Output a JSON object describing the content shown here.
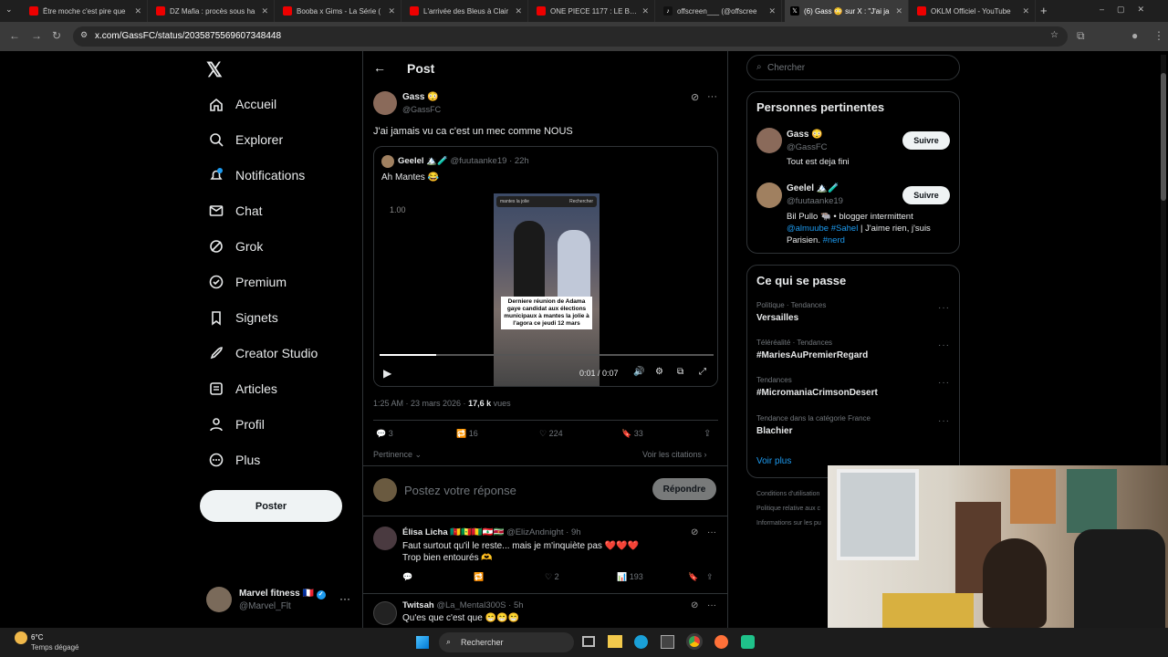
{
  "browser": {
    "tabs": [
      {
        "title": "Être moche c'est pire que",
        "icon": "youtube-icon",
        "active": false
      },
      {
        "title": "DZ Mafia : procès sous ha",
        "icon": "youtube-icon",
        "active": false
      },
      {
        "title": "Booba x Gims - La Série (",
        "icon": "youtube-icon",
        "active": false
      },
      {
        "title": "L'arrivée des Bleus à Clair",
        "icon": "youtube-icon",
        "active": false
      },
      {
        "title": "ONE PIECE 1177 : LE BORD",
        "icon": "youtube-icon",
        "active": false
      },
      {
        "title": "offscreen___ (@offscree",
        "icon": "tiktok-icon",
        "active": false
      },
      {
        "title": "(6) Gass 😳 sur X : \"J'ai ja",
        "icon": "x-icon",
        "active": true
      },
      {
        "title": "OKLM Officiel - YouTube",
        "icon": "youtube-icon",
        "active": false
      }
    ],
    "url": "x.com/GassFC/status/2035875569607348448"
  },
  "sidebar": {
    "items": [
      {
        "label": "Accueil",
        "icon": "home-icon"
      },
      {
        "label": "Explorer",
        "icon": "search-icon"
      },
      {
        "label": "Notifications",
        "icon": "bell-icon"
      },
      {
        "label": "Chat",
        "icon": "mail-icon"
      },
      {
        "label": "Grok",
        "icon": "grok-icon"
      },
      {
        "label": "Premium",
        "icon": "premium-icon"
      },
      {
        "label": "Signets",
        "icon": "bookmark-icon"
      },
      {
        "label": "Creator Studio",
        "icon": "rocket-icon"
      },
      {
        "label": "Articles",
        "icon": "article-icon"
      },
      {
        "label": "Profil",
        "icon": "person-icon"
      },
      {
        "label": "Plus",
        "icon": "more-circle-icon"
      }
    ],
    "post_button": "Poster",
    "account": {
      "name": "Marvel fitness 🇫🇷",
      "handle": "@Marvel_Flt"
    }
  },
  "post": {
    "header_title": "Post",
    "author": {
      "name": "Gass 😳",
      "handle": "@GassFC"
    },
    "text": "J'ai jamais vu ca c'est un mec comme NOUS",
    "quoted": {
      "name": "Geelel 🏔️🧪",
      "handle": "@fuutaanke19",
      "time": "· 22h",
      "text": "Ah Mantes 😂",
      "video": {
        "speed_label": "1.00",
        "search_text": "mantes la jolie",
        "search_btn": "Rechercher",
        "caption": "Derniere réunion de Adama gaye candidat aux élections municipaux à mantes la jolie à l'agora ce jeudi 12 mars",
        "time": "0:01 / 0:07",
        "progress": 0.17
      }
    },
    "meta_time": "1:25 AM · 23 mars 2026 ·",
    "views_count": "17,6 k",
    "views_label": "vues",
    "stats": {
      "replies": "3",
      "reposts": "16",
      "likes": "224",
      "bookmarks": "33"
    },
    "sort_label": "Pertinence",
    "quotes_link": "Voir les citations",
    "reply_placeholder": "Postez votre réponse",
    "reply_button": "Répondre"
  },
  "replies": [
    {
      "name": "Élisa Licha 🇨🇲🇸🇳🇬🇳🇱🇧🇸🇷",
      "handle": "@ElizAndnight",
      "time": "· 9h",
      "text": "Faut surtout qu'il le reste... mais je m'inquiète pas ❤️❤️❤️\nTrop bien entourés 🫶",
      "stats": {
        "replies": "",
        "reposts": "",
        "likes": "2",
        "views": "193"
      }
    },
    {
      "name": "Twitsah",
      "handle": "@La_Mental300S",
      "time": "· 5h",
      "text": "Qu'es que c'est que 😁😁😁"
    }
  ],
  "right": {
    "search_placeholder": "Chercher",
    "relevant_title": "Personnes pertinentes",
    "people": [
      {
        "name": "Gass 😳",
        "handle": "@GassFC",
        "bio": "Tout est deja fini",
        "follow": "Suivre"
      },
      {
        "name": "Geelel 🏔️🧪",
        "handle": "@fuutaanke19",
        "bio_plain": "Bil Pullo 🐃 • blogger intermittent",
        "bio_links": [
          "@almuube",
          "#Sahel"
        ],
        "bio_tail": "| J'aime rien, j'suis Parisien.",
        "bio_tag": "#nerd",
        "follow": "Suivre"
      }
    ],
    "trends_title": "Ce qui se passe",
    "trends": [
      {
        "category": "Politique · Tendances",
        "name": "Versailles"
      },
      {
        "category": "Téléréalité · Tendances",
        "name": "#MariesAuPremierRegard"
      },
      {
        "category": "Tendances",
        "name": "#MicromaniaCrimsonDesert"
      },
      {
        "category": "Tendance dans la catégorie France",
        "name": "Blachier"
      }
    ],
    "show_more": "Voir plus",
    "footer": [
      "Conditions d'utilisation",
      "Politique relative aux c",
      "Informations sur les pu"
    ]
  },
  "taskbar": {
    "weather_temp": "6°C",
    "weather_desc": "Temps dégagé",
    "search_label": "Rechercher"
  },
  "colors": {
    "accent": "#1d9bf0",
    "background": "#000000",
    "muted": "#71767b"
  }
}
